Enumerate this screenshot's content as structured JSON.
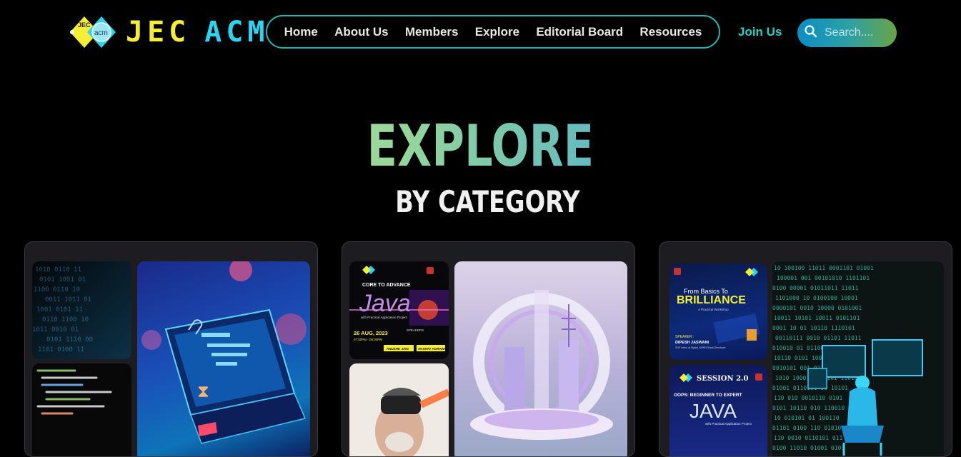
{
  "brand": {
    "name_part1": "JEC",
    "name_part2": "ACM",
    "logo_label_jec": "JEC",
    "logo_label_acm": "acm"
  },
  "nav": {
    "items": [
      {
        "label": "Home"
      },
      {
        "label": "About Us"
      },
      {
        "label": "Members"
      },
      {
        "label": "Explore"
      },
      {
        "label": "Editorial Board"
      },
      {
        "label": "Resources"
      }
    ],
    "join_label": "Join Us",
    "search_placeholder": "Search...."
  },
  "hero": {
    "title": "EXPLORE",
    "subtitle": "BY CATEGORY"
  },
  "cards": {
    "card2": {
      "poster_java": {
        "heading": "CORE TO ADVANCE",
        "title": "Java",
        "subtitle": "with Practical Application Project",
        "date": "26 AUG, 2023",
        "time": "07:00PM - 08:00PM",
        "speakers_label": "SPEAKERS",
        "speaker1": "ANUSHK JAIN",
        "speaker2": "AKSHAT AGRAWAL"
      }
    },
    "card3": {
      "poster_brilliance": {
        "heading": "From Basics To",
        "title": "BRILLIANCE",
        "subtitle": "A Practical Workshop",
        "speaker_label": "SPEAKER :",
        "speaker_name": "DIPESH JASWANI",
        "speaker_role": "SDE Intern at Digital, MERN Stack Developer"
      },
      "poster_session": {
        "heading": "SESSION 2.0",
        "sub": "OOPS: BEGINNER TO EXPERT",
        "title": "JAVA",
        "tagline": "with Practical Application Project"
      }
    }
  },
  "colors": {
    "accent_teal": "#1fb6b2",
    "logo_yellow": "#f4ee34",
    "logo_cyan": "#29d5f2"
  }
}
